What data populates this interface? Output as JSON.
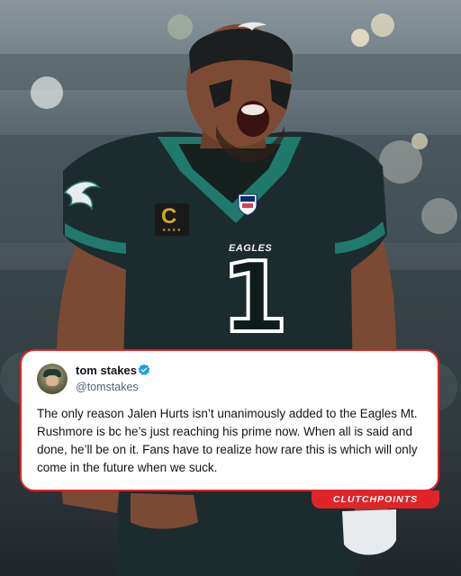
{
  "tweet": {
    "display_name": "tom stakes",
    "handle": "@tomstakes",
    "text": "The only reason Jalen Hurts isn’t unanimously added to the Eagles Mt. Rushmore is bc he’s just reaching his prime now. When all is said and done, he’ll be on it. Fans have to realize how rare this is which will only come in the future when we suck."
  },
  "photo": {
    "jersey_wordmark": "EAGLES",
    "jersey_number": "1",
    "captain_patch": "C",
    "helmet_logo": "eagle-logo-icon",
    "shield_logo": "nfl-shield-icon"
  },
  "brand": {
    "label": "CLUTCHPOINTS"
  },
  "colors": {
    "jersey": "#1c2b2d",
    "jersey_trim": "#1f7a6b",
    "accent_red": "#e0242a",
    "verified_blue": "#1d9bf0"
  }
}
